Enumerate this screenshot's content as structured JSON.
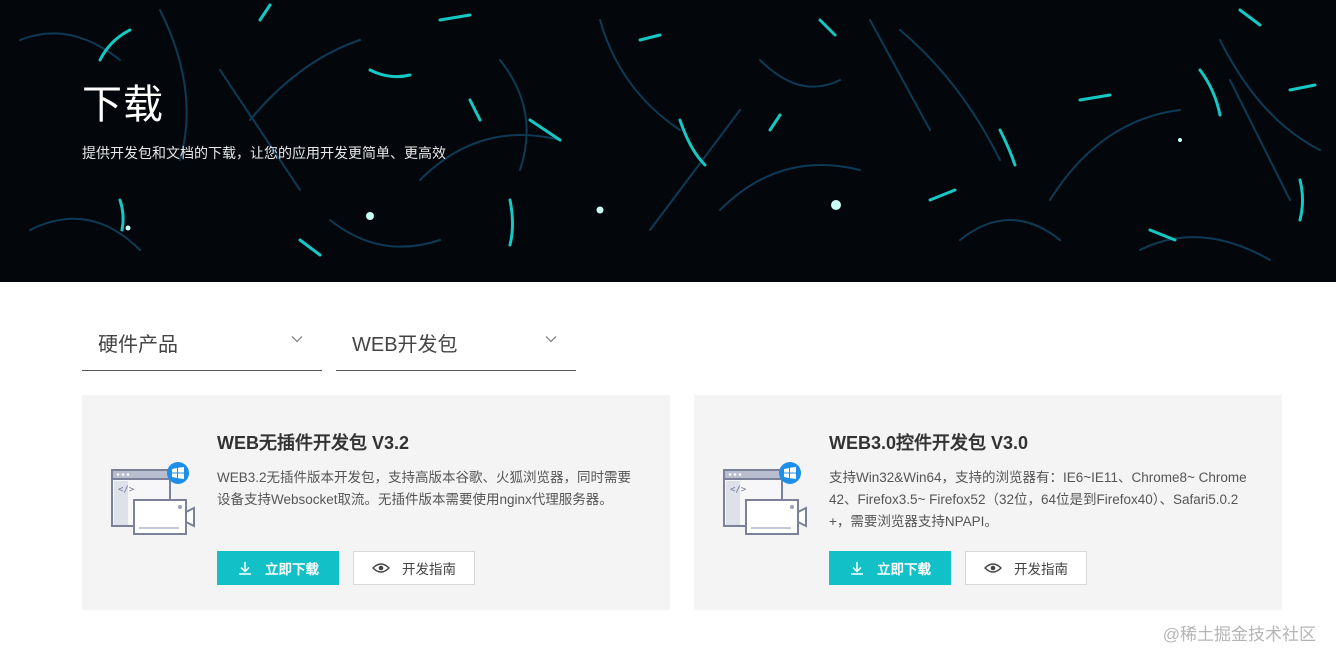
{
  "hero": {
    "title": "下载",
    "subtitle": "提供开发包和文档的下载，让您的应用开发更简单、更高效"
  },
  "filters": [
    {
      "value": "硬件产品",
      "icon": "chevron-down-icon"
    },
    {
      "value": "WEB开发包",
      "icon": "chevron-down-icon"
    }
  ],
  "cards": [
    {
      "title": "WEB无插件开发包 V3.2",
      "description": "WEB3.2无插件版本开发包，支持高版本谷歌、火狐浏览器，同时需要设备支持Websocket取流。无插件版本需要使用nginx代理服务器。",
      "download_label": "立即下载",
      "guide_label": "开发指南"
    },
    {
      "title": "WEB3.0控件开发包 V3.0",
      "description": "支持Win32&Win64，支持的浏览器有：IE6~IE11、Chrome8~ Chrome42、Firefox3.5~ Firefox52（32位，64位是到Firefox40）、Safari5.0.2+，需要浏览器支持NPAPI。",
      "download_label": "立即下载",
      "guide_label": "开发指南"
    }
  ],
  "colors": {
    "accent": "#12c0c8",
    "hero_bg": "#03070b",
    "card_bg": "#f4f4f5",
    "windows_blue": "#1e8fe8"
  },
  "watermark": "@稀土掘金技术社区"
}
